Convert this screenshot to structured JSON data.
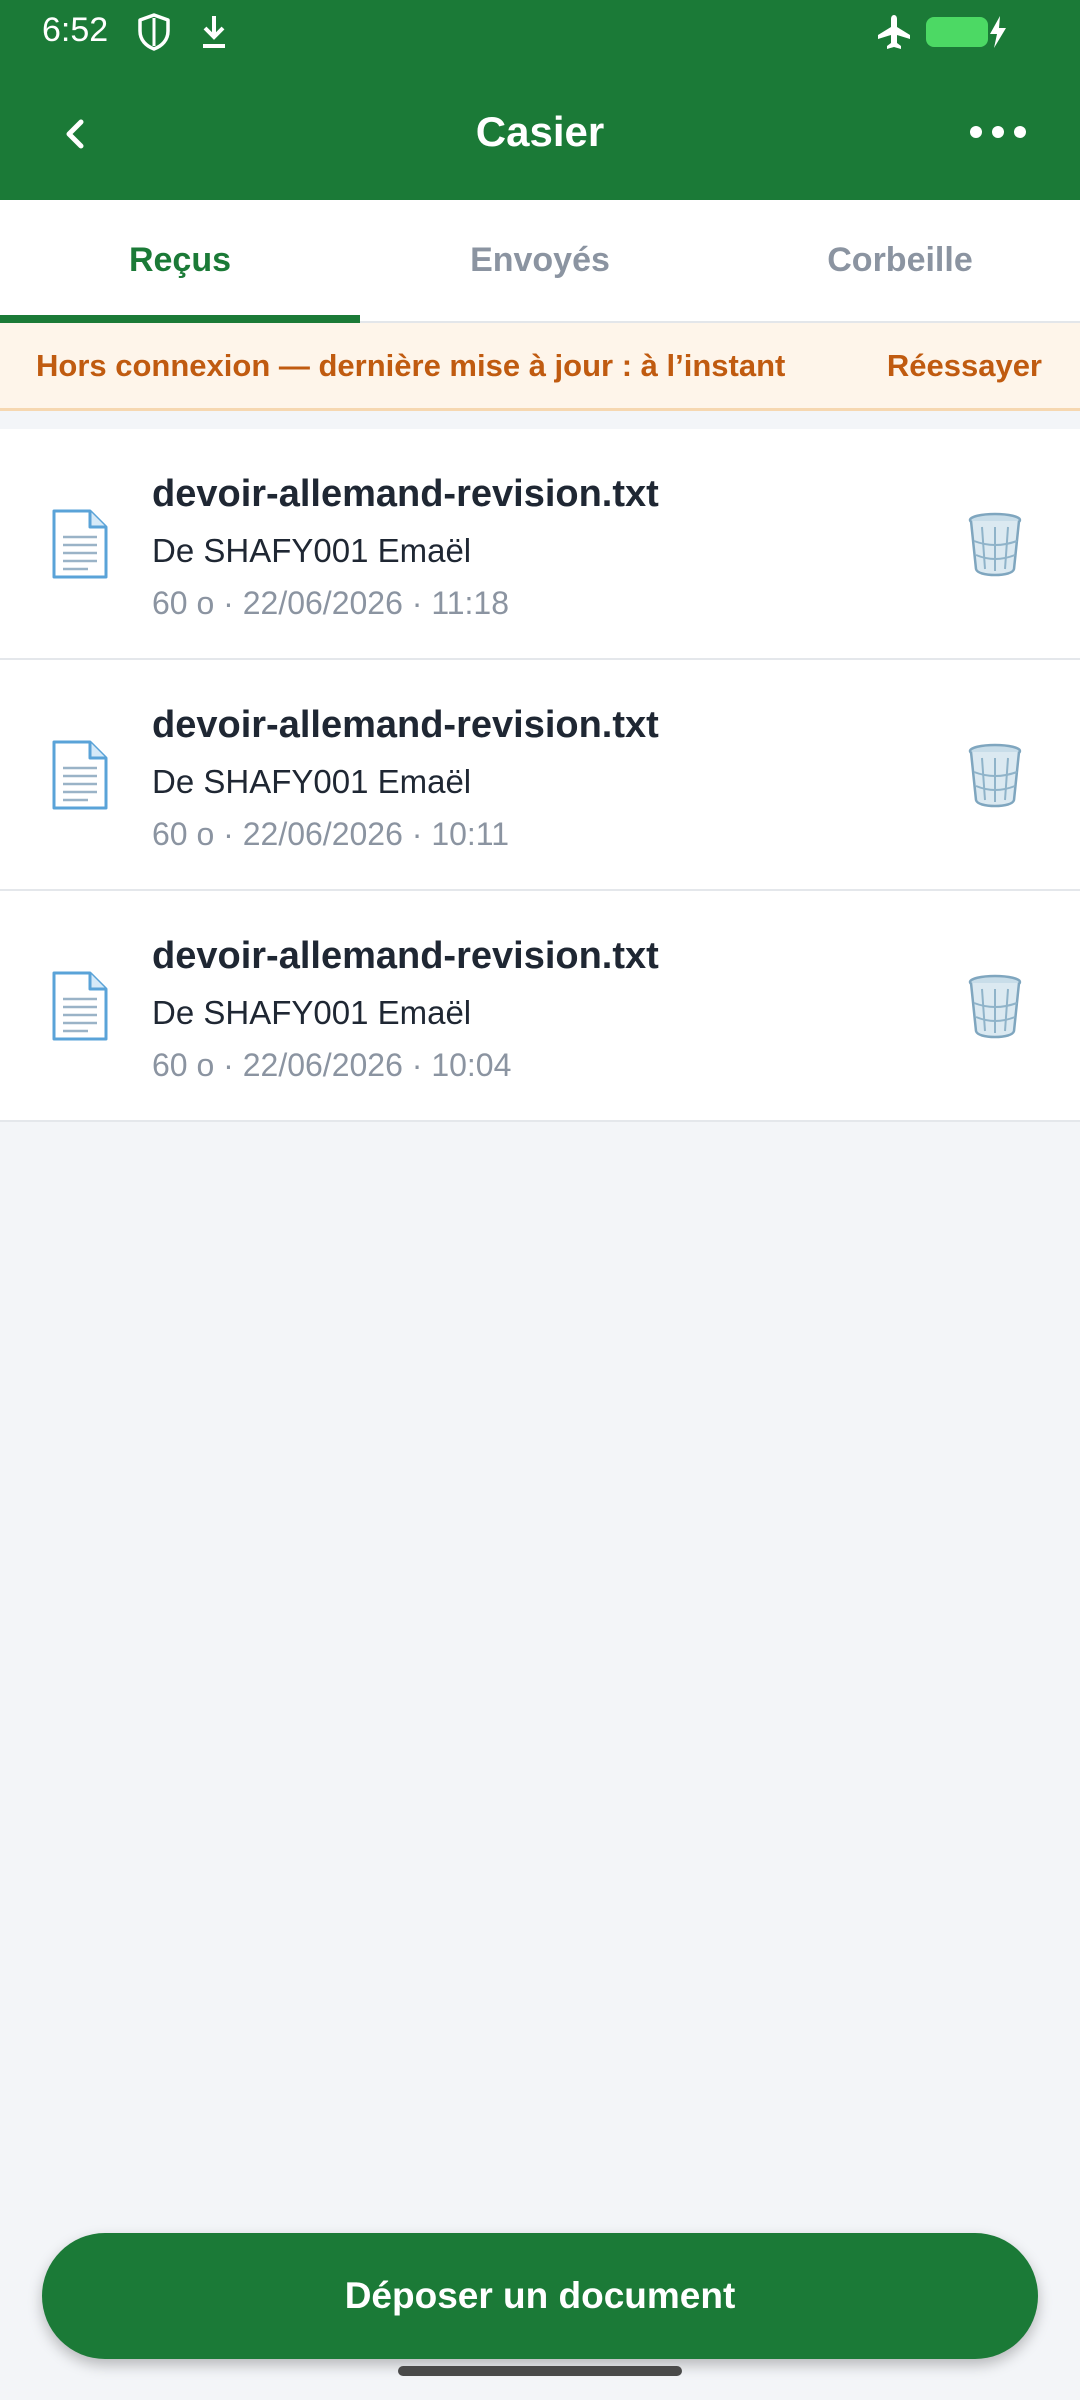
{
  "status_bar": {
    "time": "6:52",
    "icons": [
      "shield-icon",
      "download-icon",
      "airplane-mode-icon",
      "battery-charging-icon"
    ]
  },
  "header": {
    "title": "Casier",
    "back_icon": "chevron-left-icon",
    "more_icon": "more-horizontal-icon"
  },
  "tabs": [
    {
      "label": "Reçus",
      "active": true
    },
    {
      "label": "Envoyés",
      "active": false
    },
    {
      "label": "Corbeille",
      "active": false
    }
  ],
  "banner": {
    "text": "Hors connexion — dernière mise à jour : à l’instant",
    "action": "Réessayer"
  },
  "files": [
    {
      "name": "devoir-allemand-revision.txt",
      "sender": "De SHAFY001 Emaël",
      "meta": "60 o · 22/06/2026 · 11:18"
    },
    {
      "name": "devoir-allemand-revision.txt",
      "sender": "De SHAFY001 Emaël",
      "meta": "60 o · 22/06/2026 · 10:11"
    },
    {
      "name": "devoir-allemand-revision.txt",
      "sender": "De SHAFY001 Emaël",
      "meta": "60 o · 22/06/2026 · 10:04"
    }
  ],
  "fab": {
    "label": "Déposer un document"
  },
  "colors": {
    "brand_green": "#1b7a37",
    "warning_orange": "#c05b10",
    "banner_bg": "#fef5ea"
  }
}
